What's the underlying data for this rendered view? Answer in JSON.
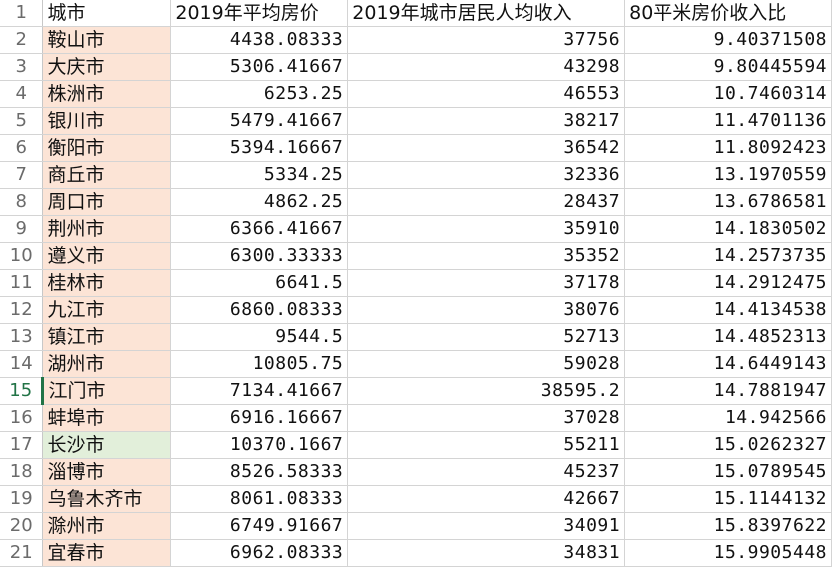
{
  "header": {
    "row_number": "1",
    "col_city": "城市",
    "col_price": "2019年平均房价",
    "col_income": "2019年城市居民人均收入",
    "col_ratio": "80平米房价收入比"
  },
  "rows": [
    {
      "n": "2",
      "city": "鞍山市",
      "price": "4438.08333",
      "income": "37756",
      "ratio": "9.40371508"
    },
    {
      "n": "3",
      "city": "大庆市",
      "price": "5306.41667",
      "income": "43298",
      "ratio": "9.80445594"
    },
    {
      "n": "4",
      "city": "株洲市",
      "price": "6253.25",
      "income": "46553",
      "ratio": "10.7460314"
    },
    {
      "n": "5",
      "city": "银川市",
      "price": "5479.41667",
      "income": "38217",
      "ratio": "11.4701136"
    },
    {
      "n": "6",
      "city": "衡阳市",
      "price": "5394.16667",
      "income": "36542",
      "ratio": "11.8092423"
    },
    {
      "n": "7",
      "city": "商丘市",
      "price": "5334.25",
      "income": "32336",
      "ratio": "13.1970559"
    },
    {
      "n": "8",
      "city": "周口市",
      "price": "4862.25",
      "income": "28437",
      "ratio": "13.6786581"
    },
    {
      "n": "9",
      "city": "荆州市",
      "price": "6366.41667",
      "income": "35910",
      "ratio": "14.1830502"
    },
    {
      "n": "10",
      "city": "遵义市",
      "price": "6300.33333",
      "income": "35352",
      "ratio": "14.2573735"
    },
    {
      "n": "11",
      "city": "桂林市",
      "price": "6641.5",
      "income": "37178",
      "ratio": "14.2912475"
    },
    {
      "n": "12",
      "city": "九江市",
      "price": "6860.08333",
      "income": "38076",
      "ratio": "14.4134538"
    },
    {
      "n": "13",
      "city": "镇江市",
      "price": "9544.5",
      "income": "52713",
      "ratio": "14.4852313"
    },
    {
      "n": "14",
      "city": "湖州市",
      "price": "10805.75",
      "income": "59028",
      "ratio": "14.6449143"
    },
    {
      "n": "15",
      "city": "江门市",
      "price": "7134.41667",
      "income": "38595.2",
      "ratio": "14.7881947"
    },
    {
      "n": "16",
      "city": "蚌埠市",
      "price": "6916.16667",
      "income": "37028",
      "ratio": "14.942566"
    },
    {
      "n": "17",
      "city": "长沙市",
      "price": "10370.1667",
      "income": "55211",
      "ratio": "15.0262327"
    },
    {
      "n": "18",
      "city": "淄博市",
      "price": "8526.58333",
      "income": "45237",
      "ratio": "15.0789545"
    },
    {
      "n": "19",
      "city": "乌鲁木齐市",
      "price": "8061.08333",
      "income": "42667",
      "ratio": "15.1144132"
    },
    {
      "n": "20",
      "city": "滁州市",
      "price": "6749.91667",
      "income": "34091",
      "ratio": "15.8397622"
    },
    {
      "n": "21",
      "city": "宜春市",
      "price": "6962.08333",
      "income": "34831",
      "ratio": "15.9905448"
    }
  ],
  "colors": {
    "city_fill": "#fce4d6",
    "city_highlight_fill": "#e2efda",
    "active_row_marker": "#217346"
  }
}
